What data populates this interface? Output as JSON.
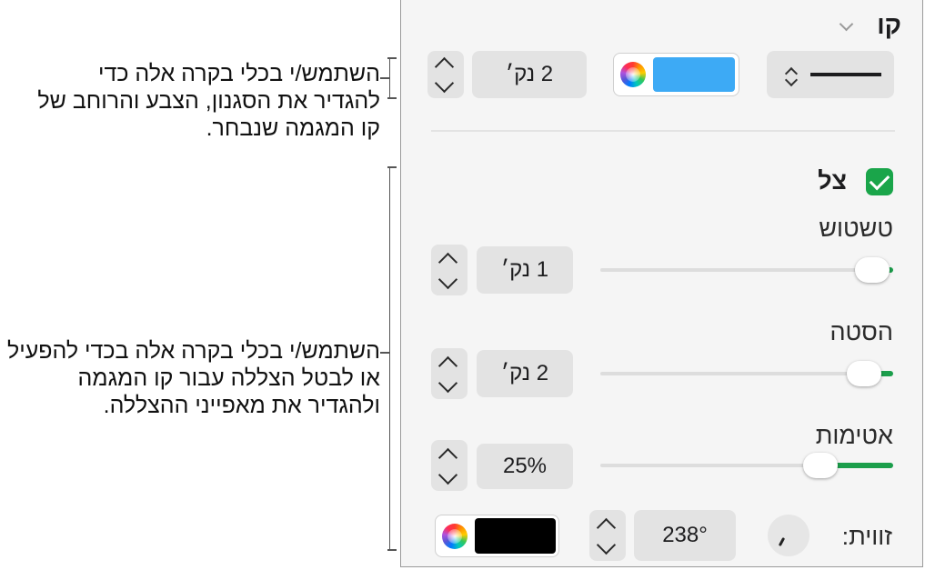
{
  "callouts": {
    "stroke_text": "השתמש/י בכלי בקרה אלה כדי להגדיר את הסגנון, הצבע והרוחב של קו המגמה שנבחר.",
    "shadow_text": "השתמש/י בכלי בקרה אלה בכדי להפעיל או לבטל הצללה עבור קו המגמה ולהגדיר את מאפייני ההצללה."
  },
  "line_section": {
    "title": "קו",
    "width_value": "2 נק׳",
    "color": "#3daaf5"
  },
  "shadow": {
    "title": "צל",
    "enabled": true,
    "blur": {
      "label": "טשטוש",
      "value": "1 נק׳",
      "level": 0.05
    },
    "offset": {
      "label": "הסטה",
      "value": "2 נק׳",
      "level": 0.1
    },
    "opacity": {
      "label": "אטימות",
      "value": "25%",
      "level": 0.25
    },
    "angle": {
      "label": "זווית:",
      "value": "238°"
    },
    "color": "#000000"
  },
  "colors": {
    "accent_green": "#1aa54a",
    "slider_fill": "#1b9e4b"
  }
}
